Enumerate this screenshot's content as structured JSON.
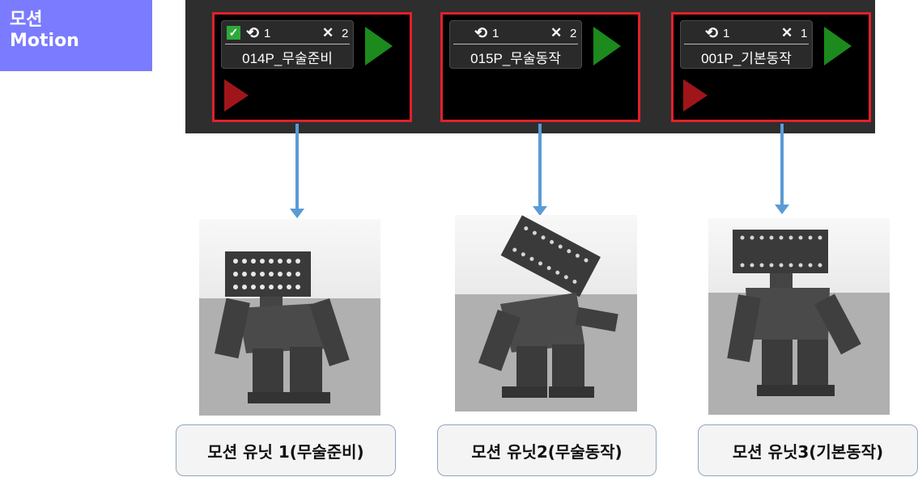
{
  "corner_title": {
    "korean": "모션",
    "english": "Motion"
  },
  "units": [
    {
      "checked": true,
      "repeat_icon": "loop-icon",
      "repeat_count": "1",
      "times_icon": "close-icon",
      "times_count": "2",
      "name": "014P_무술준비",
      "has_red_play": true
    },
    {
      "checked": false,
      "repeat_icon": "loop-icon",
      "repeat_count": "1",
      "times_icon": "close-icon",
      "times_count": "2",
      "name": "015P_무술동작",
      "has_red_play": false
    },
    {
      "checked": false,
      "repeat_icon": "loop-icon",
      "repeat_count": "1",
      "times_icon": "close-icon",
      "times_count": "1",
      "name": "001P_기본동작",
      "has_red_play": true
    }
  ],
  "captions": [
    "모션 유닛 1(무술준비)",
    "모션 유닛2(무술동작)",
    "모션 유닛3(기본동작)"
  ],
  "colors": {
    "corner_bg": "#7b7bff",
    "highlight_border": "#e2202a",
    "play_green": "#1c8a1c",
    "play_red": "#a0151a",
    "arrow": "#5b9bd5"
  }
}
